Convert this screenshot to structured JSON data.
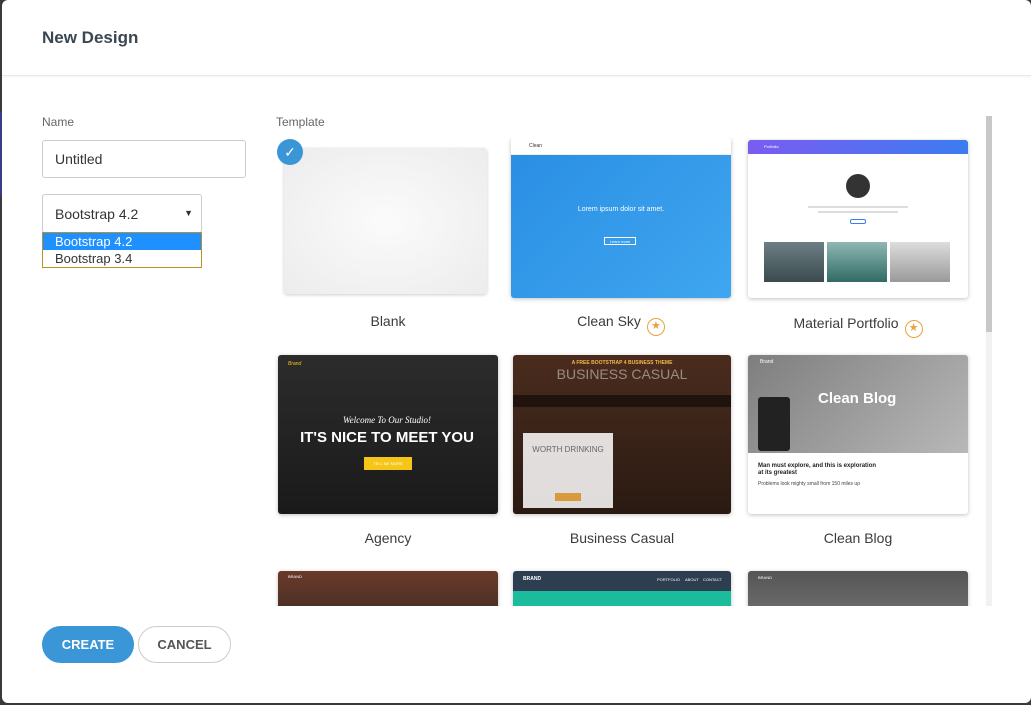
{
  "modal": {
    "title": "New Design"
  },
  "form": {
    "name_label": "Name",
    "name_value": "Untitled",
    "framework_selected": "Bootstrap 4.2",
    "framework_options": [
      "Bootstrap 4.2",
      "Bootstrap 3.4"
    ]
  },
  "templates_label": "Template",
  "templates": [
    {
      "name": "Blank",
      "selected": true,
      "premium": false
    },
    {
      "name": "Clean Sky",
      "selected": false,
      "premium": true,
      "hero": "Lorem ipsum dolor sit amet.",
      "brand": "Clean",
      "cta": "Learn more"
    },
    {
      "name": "Material Portfolio",
      "selected": false,
      "premium": true,
      "brand": "Portfolio"
    },
    {
      "name": "Agency",
      "selected": false,
      "premium": false,
      "brand": "Brand",
      "tagline": "Welcome To Our Studio!",
      "headline": "IT'S NICE TO MEET YOU",
      "cta": "TELL ME MORE"
    },
    {
      "name": "Business Casual",
      "selected": false,
      "premium": false,
      "tagline": "A FREE BOOTSTRAP 4 BUSINESS THEME",
      "headline": "BUSINESS CASUAL",
      "box_title": "WORTH DRINKING"
    },
    {
      "name": "Clean Blog",
      "selected": false,
      "premium": false,
      "brand": "Brand",
      "headline": "Clean Blog",
      "post_title": "Man must explore, and this is exploration at its greatest",
      "post_subtitle": "Problems look mighty small from 150 miles up"
    },
    {
      "name": "",
      "brand": "BRAND"
    },
    {
      "name": "",
      "brand": "BRAND",
      "nav": [
        "PORTFOLIO",
        "ABOUT",
        "CONTACT"
      ]
    },
    {
      "name": "",
      "brand": "BRAND"
    }
  ],
  "actions": {
    "create": "CREATE",
    "cancel": "CANCEL"
  },
  "colors": {
    "accent": "#3b96d8",
    "star": "#e8a33d"
  }
}
